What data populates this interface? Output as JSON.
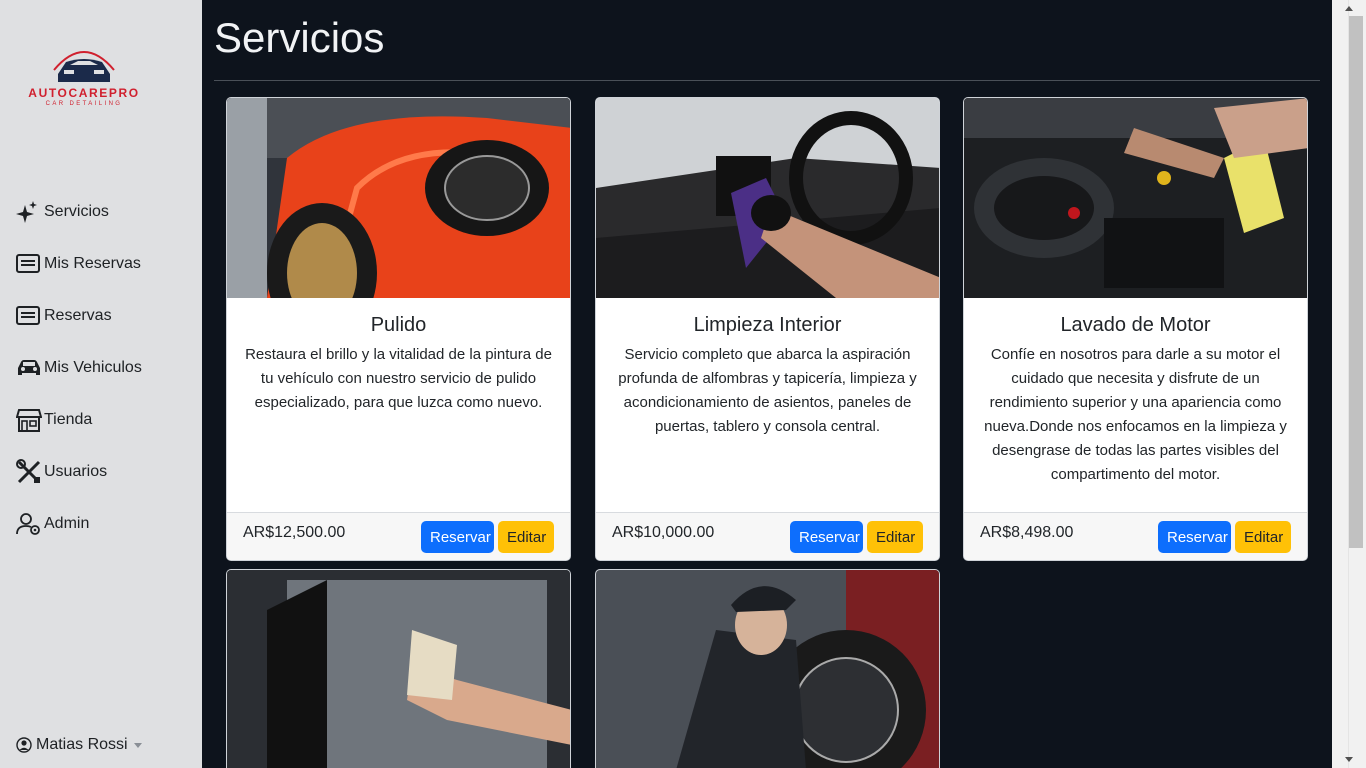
{
  "brand": {
    "name": "AUTOCAREPRO",
    "tagline": "CAR DETAILING"
  },
  "nav": [
    {
      "label": "Servicios",
      "icon": "sparkles-icon"
    },
    {
      "label": "Mis Reservas",
      "icon": "list-icon"
    },
    {
      "label": "Reservas",
      "icon": "list-icon"
    },
    {
      "label": "Mis Vehiculos",
      "icon": "car-icon"
    },
    {
      "label": "Tienda",
      "icon": "shop-icon"
    },
    {
      "label": "Usuarios",
      "icon": "tools-icon"
    },
    {
      "label": "Admin",
      "icon": "user-gear-icon"
    }
  ],
  "user": {
    "name": "Matias Rossi"
  },
  "page": {
    "title": "Servicios"
  },
  "buttons": {
    "reserve": "Reservar",
    "edit": "Editar"
  },
  "services": [
    {
      "name": "Pulido",
      "description": "Restaura el brillo y la vitalidad de la pintura de tu vehículo con nuestro servicio de pulido especializado, para que luzca como nuevo.",
      "price": "AR$12,500.00"
    },
    {
      "name": "Limpieza Interior",
      "description": "Servicio completo que abarca la aspiración profunda de alfombras y tapicería, limpieza y acondicionamiento de asientos, paneles de puertas, tablero y consola central.",
      "price": "AR$10,000.00"
    },
    {
      "name": "Lavado de Motor",
      "description": "Confíe en nosotros para darle a su motor el cuidado que necesita y disfrute de un rendimiento superior y una apariencia como nueva.Donde nos enfocamos en la limpieza y desengrase de todas las partes visibles del compartimento del motor.",
      "price": "AR$8,498.00"
    }
  ],
  "colors": {
    "primary": "#0d6efd",
    "warning": "#ffc107",
    "brand_red": "#d0202e",
    "background": "#0d131c"
  }
}
